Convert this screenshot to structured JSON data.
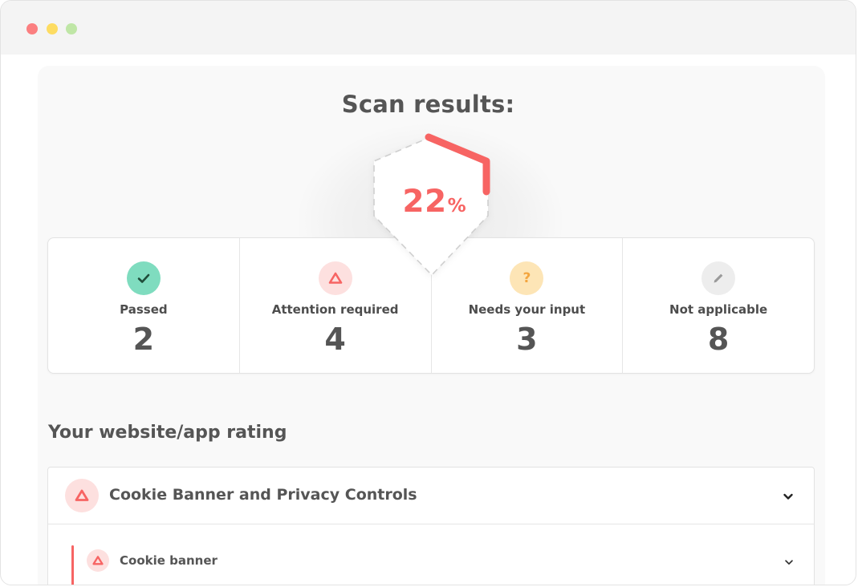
{
  "window": {
    "controls": [
      "close",
      "minimize",
      "maximize"
    ]
  },
  "scan": {
    "title": "Scan results:",
    "score_value": "22",
    "score_unit": "%",
    "score_fraction": 0.22,
    "accent_color": "#f76463"
  },
  "stats": [
    {
      "label": "Passed",
      "value": "2",
      "icon": "check-icon",
      "icon_bg": "#7fdcbf",
      "icon_color": "#1f4d3a"
    },
    {
      "label": "Attention required",
      "value": "4",
      "icon": "warning-triangle-icon",
      "icon_bg": "#fde0df",
      "icon_color": "#f76463"
    },
    {
      "label": "Needs your input",
      "value": "3",
      "icon": "question-icon",
      "icon_bg": "#fde5b6",
      "icon_color": "#f3a53f"
    },
    {
      "label": "Not applicable",
      "value": "8",
      "icon": "pencil-icon",
      "icon_bg": "#ededed",
      "icon_color": "#9a9a9a"
    }
  ],
  "rating": {
    "heading": "Your website/app rating",
    "sections": [
      {
        "title": "Cookie Banner and Privacy Controls",
        "icon": "warning-triangle-icon",
        "expanded": true,
        "items": [
          {
            "title": "Cookie banner",
            "icon": "warning-triangle-icon"
          }
        ]
      }
    ]
  }
}
